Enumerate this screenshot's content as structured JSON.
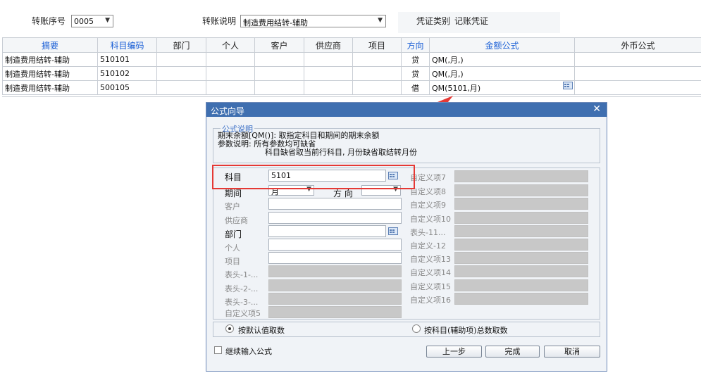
{
  "header": {
    "seq_label": "转账序号",
    "seq_value": "0005",
    "desc_label": "转账说明",
    "desc_value": "制造费用结转-辅助",
    "voucher_type_label": "凭证类别",
    "voucher_type_value": "记账凭证"
  },
  "grid": {
    "columns": [
      "摘要",
      "科目编码",
      "部门",
      "个人",
      "客户",
      "供应商",
      "项目",
      "方向",
      "金额公式",
      "外币公式"
    ],
    "rows": [
      {
        "summary": "制造费用结转-辅助",
        "code": "510101",
        "dept": "",
        "person": "",
        "customer": "",
        "supplier": "",
        "project": "",
        "direction": "贷",
        "formula": "QM(,月,)",
        "fx": ""
      },
      {
        "summary": "制造费用结转-辅助",
        "code": "510102",
        "dept": "",
        "person": "",
        "customer": "",
        "supplier": "",
        "project": "",
        "direction": "贷",
        "formula": "QM(,月,)",
        "fx": ""
      },
      {
        "summary": "制造费用结转-辅助",
        "code": "500105",
        "dept": "",
        "person": "",
        "customer": "",
        "supplier": "",
        "project": "",
        "direction": "借",
        "formula": "QM(5101,月)",
        "fx": ""
      }
    ]
  },
  "dialog": {
    "title": "公式向导",
    "close": "✕",
    "desc_legend": "公式说明",
    "desc_line1": "期末余额[QM()]: 取指定科目和期间的期末余额",
    "desc_line2": "参数说明: 所有参数均可缺省",
    "desc_line3": "科目缺省取当前行科目, 月份缺省取结转月份",
    "fields": {
      "subject_label": "科目",
      "subject_value": "5101",
      "period_label": "期间",
      "period_value": "月",
      "direction_label": "方 向",
      "direction_value": "",
      "customer_label": "客户",
      "supplier_label": "供应商",
      "dept_label": "部门",
      "person_label": "个人",
      "project_label": "项目",
      "h1_label": "表头-1-...",
      "h2_label": "表头-2-...",
      "h3_label": "表头-3-...",
      "c5_label": "自定义项5",
      "c7_label": "自定义项7",
      "c8_label": "自定义项8",
      "c9_label": "自定义项9",
      "c10_label": "自定义项10",
      "h11_label": "表头-11...",
      "c12_label": "自定义-12",
      "c13_label": "自定义项13",
      "c14_label": "自定义项14",
      "c15_label": "自定义项15",
      "c16_label": "自定义项16"
    },
    "radio_default": "按默认值取数",
    "radio_total": "按科目(辅助项)总数取数",
    "continue_label": "继续输入公式",
    "btn_prev": "上一步",
    "btn_finish": "完成",
    "btn_cancel": "取消"
  },
  "colors": {
    "accent_blue": "#1a5fd6",
    "title_bar": "#3f6fb0",
    "highlight_red": "#e53935"
  }
}
